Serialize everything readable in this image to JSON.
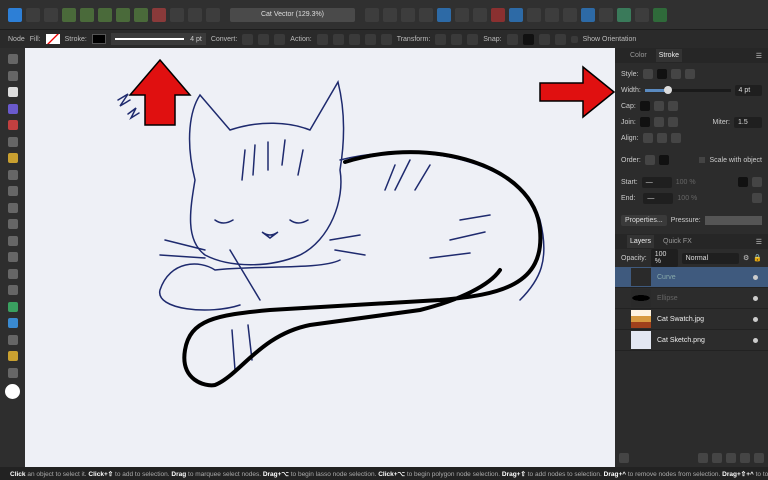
{
  "toolbar": {
    "document_title": "Cat Vector (129.3%)"
  },
  "context": {
    "mode": "Node",
    "fill_label": "Fill:",
    "stroke_label": "Stroke:",
    "stroke_width": "4 pt",
    "convert_label": "Convert:",
    "action_label": "Action:",
    "transform_label": "Transform:",
    "snap_label": "Snap:",
    "show_orientation": "Show Orientation"
  },
  "stroke_panel": {
    "tabs": [
      "Color",
      "Stroke"
    ],
    "style_label": "Style:",
    "width_label": "Width:",
    "width_value": "4 pt",
    "width_fraction": 0.27,
    "cap_label": "Cap:",
    "join_label": "Join:",
    "miter_label": "Miter:",
    "miter_value": "1.5",
    "align_label": "Align:",
    "order_label": "Order:",
    "scale_with_object": "Scale with object",
    "start_label": "Start:",
    "end_label": "End:",
    "start_pct": "100 %",
    "end_pct": "100 %",
    "properties_button": "Properties...",
    "pressure_label": "Pressure:"
  },
  "layers_panel": {
    "tabs": [
      "Layers",
      "Quick FX"
    ],
    "opacity_label": "Opacity:",
    "opacity_value": "100 %",
    "blend_mode": "Normal",
    "layers": [
      {
        "name": "Curve"
      },
      {
        "name": "Ellipse"
      },
      {
        "name": "Cat Swatch.jpg"
      },
      {
        "name": "Cat Sketch.png"
      }
    ]
  },
  "status": {
    "parts": [
      [
        "Click",
        " an object to select it. "
      ],
      [
        "Click+⇧",
        " to add to selection. "
      ],
      [
        "Drag",
        " to marquee select nodes. "
      ],
      [
        "Drag+⌥",
        " to begin lasso node selection. "
      ],
      [
        "Click+⌥",
        " to begin polygon node selection. "
      ],
      [
        "Drag+⇧",
        " to add nodes to selection. "
      ],
      [
        "Drag+^",
        " to remove nodes from selection. "
      ],
      [
        "Drag+⇧+^",
        " to toggle node"
      ]
    ]
  },
  "colors": {
    "accent": "#3f5a7e",
    "arrow": "#e01010",
    "sketch": "#1e2a6e"
  }
}
